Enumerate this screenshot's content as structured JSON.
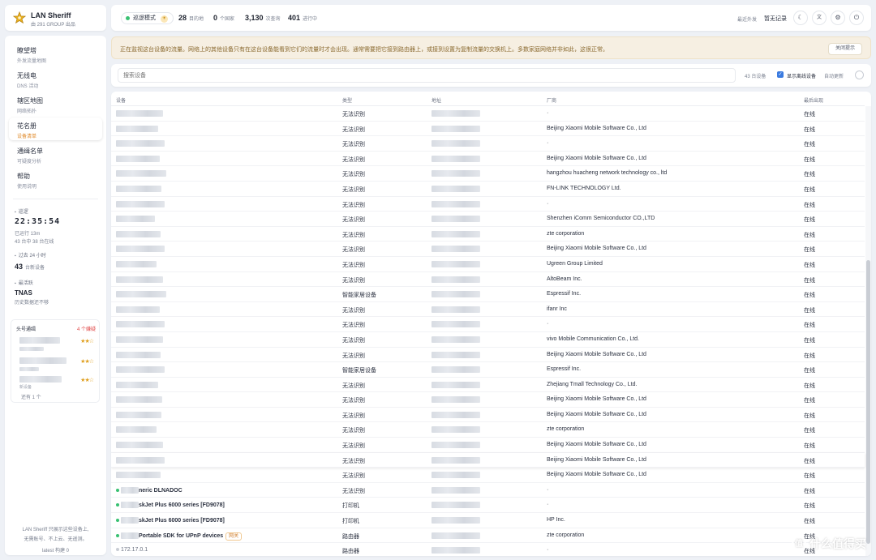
{
  "brand": {
    "name": "LAN Sheriff",
    "sub": "由 291 GROUP 出品"
  },
  "nav": [
    {
      "title": "瞭望塔",
      "sub": "外发流量地图"
    },
    {
      "title": "无线电",
      "sub": "DNS 活动"
    },
    {
      "title": "辖区地图",
      "sub": "网络拓扑"
    },
    {
      "title": "花名册",
      "sub": "设备清单"
    },
    {
      "title": "通缉名单",
      "sub": "可疑度分析"
    },
    {
      "title": "帮助",
      "sub": "使用说明"
    }
  ],
  "sidebar_stats": {
    "uptime_label": "巡逻",
    "clock": "22:35:54",
    "running": "已运行 13m",
    "online": "43 台中 38 台在线",
    "past24_label": "过去 24 小时",
    "new_devices_num": "43",
    "new_devices_label": "台新设备",
    "busiest_label": "最活跃",
    "busiest_name": "TNAS",
    "busiest_sub": "历史数据还不够"
  },
  "hot_list": {
    "title": "头号通缉",
    "count": "4 个嫌疑",
    "items": [
      {
        "stars": "★★☆"
      },
      {
        "stars": "★★☆"
      },
      {
        "stars": "★★☆",
        "sub": "新设备"
      }
    ],
    "more": "还有 1 个"
  },
  "sidebar_footer": [
    "LAN Sheriff 只展示这些设备上,",
    "无需账号、不上云、无遥测。",
    "latest 构建 0"
  ],
  "header": {
    "mode": "巡逻模式",
    "mode_icon": "☀",
    "targets_num": "28",
    "targets_label": "目的地",
    "countries_num": "0",
    "countries_label": "个国家",
    "queries_num": "3,130",
    "queries_label": "次查询",
    "procs_num": "401",
    "procs_label": "进行中",
    "recent_label": "最近外发",
    "recent_val": "暂无记录",
    "buttons": [
      "☾",
      "文",
      "⚙",
      "⏻"
    ]
  },
  "banner": {
    "text": "正在监视这台设备的流量。网络上的其他设备只有在这台设备能看到它们的流量时才会出现。通常需要把它接到路由器上，或接到设置为复制流量的交换机上。多数家庭网络并非如此，这很正常。",
    "button": "关闭提示"
  },
  "search": {
    "placeholder": "搜索设备",
    "count": "43 台设备",
    "show_offline": "显示离线设备",
    "refresh": "自动更新"
  },
  "table": {
    "headers": {
      "device": "设备",
      "type": "类型",
      "address": "地址",
      "vendor": "厂商",
      "last_seen": "最后出现"
    },
    "rows": [
      {
        "type": "无法识别",
        "vendor": "·",
        "status": "在线",
        "dev": "",
        "addr": "68.1"
      },
      {
        "type": "无法识别",
        "vendor": "Beijing Xiaomi Mobile Software Co., Ltd",
        "status": "在线"
      },
      {
        "type": "无法识别",
        "vendor": "·",
        "status": "在线"
      },
      {
        "type": "无法识别",
        "vendor": "Beijing Xiaomi Mobile Software Co., Ltd",
        "status": "在线"
      },
      {
        "type": "无法识别",
        "vendor": "hangzhou huacheng network technology co., ltd",
        "status": "在线"
      },
      {
        "type": "无法识别",
        "vendor": "FN-LINK TECHNOLOGY Ltd.",
        "status": "在线"
      },
      {
        "type": "无法识别",
        "vendor": "·",
        "status": "在线"
      },
      {
        "type": "无法识别",
        "vendor": "Shenzhen iComm Semiconductor CO.,LTD",
        "status": "在线"
      },
      {
        "type": "无法识别",
        "vendor": "zte corporation",
        "status": "在线"
      },
      {
        "type": "无法识别",
        "vendor": "Beijing Xiaomi Mobile Software Co., Ltd",
        "status": "在线"
      },
      {
        "type": "无法识别",
        "vendor": "Ugreen Group Limited",
        "status": "在线"
      },
      {
        "type": "无法识别",
        "vendor": "AltoBeam Inc.",
        "status": "在线"
      },
      {
        "type": "智能家居设备",
        "vendor": "Espressif Inc.",
        "status": "在线"
      },
      {
        "type": "无法识别",
        "vendor": "ifanr Inc",
        "status": "在线"
      },
      {
        "type": "无法识别",
        "vendor": "·",
        "status": "在线"
      },
      {
        "type": "无法识别",
        "vendor": "vivo Mobile Communication Co., Ltd.",
        "status": "在线"
      },
      {
        "type": "无法识别",
        "vendor": "Beijing Xiaomi Mobile Software Co., Ltd",
        "status": "在线"
      },
      {
        "type": "智能家居设备",
        "vendor": "Espressif Inc.",
        "status": "在线"
      },
      {
        "type": "无法识别",
        "vendor": "Zhejiang Tmall Technology Co., Ltd.",
        "status": "在线"
      },
      {
        "type": "无法识别",
        "vendor": "Beijing Xiaomi Mobile Software Co., Ltd",
        "status": "在线"
      },
      {
        "type": "无法识别",
        "vendor": "Beijing Xiaomi Mobile Software Co., Ltd",
        "status": "在线"
      },
      {
        "type": "无法识别",
        "vendor": "zte corporation",
        "status": "在线"
      },
      {
        "type": "无法识别",
        "vendor": "Beijing Xiaomi Mobile Software Co., Ltd",
        "status": "在线"
      },
      {
        "type": "无法识别",
        "vendor": "Beijing Xiaomi Mobile Software Co., Ltd",
        "status": "在线"
      },
      {
        "type": "无法识别",
        "vendor": "Beijing Xiaomi Mobile Software Co., Ltd",
        "status": "在线"
      },
      {
        "type": "无法识别",
        "vendor": "·",
        "status": "在线",
        "dev": "neric DLNADOC"
      },
      {
        "type": "打印机",
        "vendor": "·",
        "status": "在线",
        "dev": "skJet Plus 6000 series [FD9078]"
      },
      {
        "type": "打印机",
        "vendor": "HP Inc.",
        "status": "在线",
        "dev": "skJet Plus 6000 series [FD9078]"
      },
      {
        "type": "路由器",
        "vendor": "zte corporation",
        "status": "在线",
        "dev": "Portable SDK for UPnP devices",
        "tag": "网关"
      },
      {
        "type": "路由器",
        "vendor": "·",
        "status": "在线",
        "dev": "172.17.0.1"
      }
    ]
  },
  "watermark": "什么值得买",
  "colors": {
    "accent": "#3b7be0",
    "online": "#39c172",
    "warning_bg": "#f6efe2",
    "star": "#e0a020"
  }
}
